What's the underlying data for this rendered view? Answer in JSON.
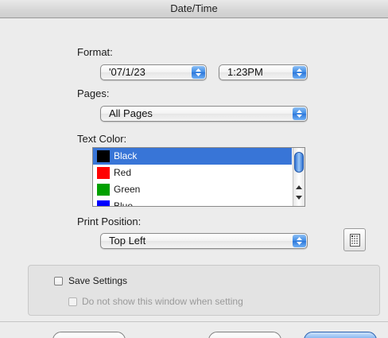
{
  "window": {
    "title": "Date/Time"
  },
  "format": {
    "label": "Format:",
    "date_value": "'07/1/23",
    "time_value": "1:23PM"
  },
  "pages": {
    "label": "Pages:",
    "value": "All Pages"
  },
  "text_color": {
    "label": "Text Color:",
    "selected_index": 0,
    "items": [
      {
        "label": "Black",
        "color": "#000000"
      },
      {
        "label": "Red",
        "color": "#ff0000"
      },
      {
        "label": "Green",
        "color": "#00a000"
      },
      {
        "label": "Blue",
        "color": "#0000ff"
      }
    ]
  },
  "print_position": {
    "label": "Print Position:",
    "value": "Top Left",
    "position_icon": "page-position-icon"
  },
  "settings": {
    "save_label": "Save Settings",
    "dont_show_label": "Do not show this window when setting"
  },
  "colors": {
    "accent": "#3875d7",
    "popup_arrow": "#3d8ae6"
  }
}
